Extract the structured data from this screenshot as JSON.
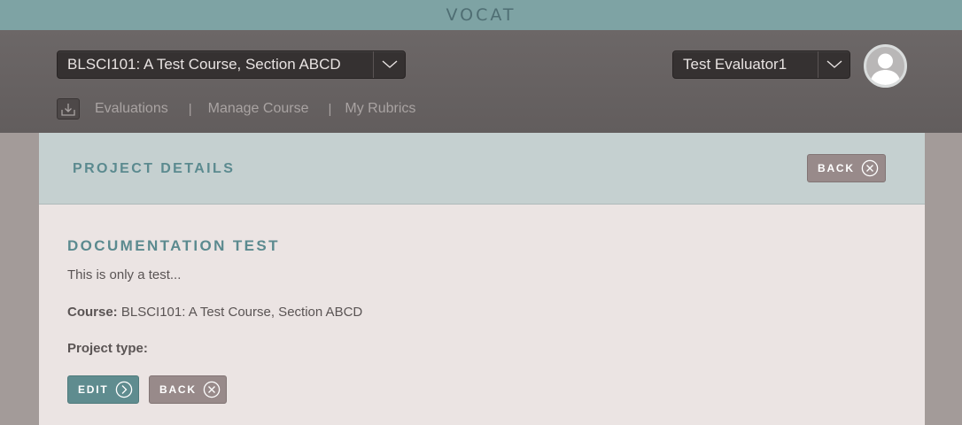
{
  "brand": {
    "logo_text": "VOCAT"
  },
  "header": {
    "course_selector": {
      "label": "BLSCI101: A Test Course, Section ABCD"
    },
    "user_selector": {
      "label": "Test Evaluator1"
    },
    "nav": {
      "items": [
        {
          "label": "Evaluations"
        },
        {
          "label": "Manage Course"
        },
        {
          "label": "My Rubrics"
        }
      ],
      "separator": "|"
    }
  },
  "panel": {
    "title": "PROJECT DETAILS",
    "back_label": "BACK"
  },
  "project": {
    "name": "DOCUMENTATION TEST",
    "description": "This is only a test...",
    "course_label": "Course:",
    "course_value": "BLSCI101: A Test Course, Section ABCD",
    "type_label": "Project type:",
    "type_value": "",
    "edit_label": "EDIT",
    "back_label": "BACK"
  },
  "colors": {
    "brand_bar": "#7ea3a4",
    "header": "#676262",
    "accent_teal": "#5b8a8f",
    "panel_bg": "#ebe4e3"
  },
  "icons": [
    "chevron-down-icon",
    "user-avatar-icon",
    "download-icon",
    "close-circle-icon",
    "arrow-right-circle-icon"
  ]
}
